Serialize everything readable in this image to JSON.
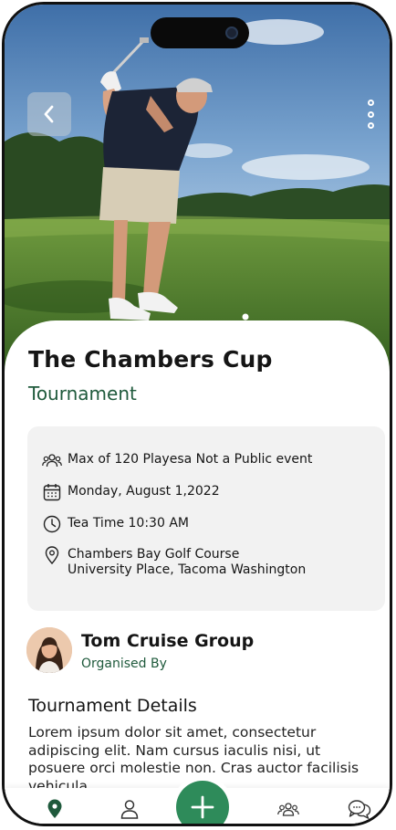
{
  "event": {
    "title": "The Chambers Cup",
    "category": "Tournament"
  },
  "info": {
    "players": "Max of 120 Playesa Not a Public event",
    "date": "Monday, August 1,2022",
    "tee_time": "Tea Time 10:30 AM",
    "location_line1": "Chambers Bay Golf Course",
    "location_line2": "University Place, Tacoma Washington"
  },
  "organiser": {
    "name": "Tom Cruise Group",
    "role": "Organised By"
  },
  "details": {
    "heading": "Tournament Details",
    "body": "Lorem ipsum dolor sit amet, consectetur adipiscing elit. Nam cursus iaculis nisi, ut posuere orci molestie non. Cras auctor facilisis vehicula."
  },
  "icons": {
    "back": "chevron-left-icon",
    "more": "more-vertical-icon",
    "players": "group-icon",
    "date": "calendar-icon",
    "time": "clock-icon",
    "location": "location-pin-icon",
    "tab_map": "map-pin-icon",
    "tab_profile": "user-icon",
    "tab_add": "plus-icon",
    "tab_groups": "group-icon",
    "tab_chat": "chat-icon"
  },
  "colors": {
    "brand_green": "#1f5a3c",
    "fab_green": "#2e8b5a",
    "card_bg": "#f2f2f2"
  }
}
